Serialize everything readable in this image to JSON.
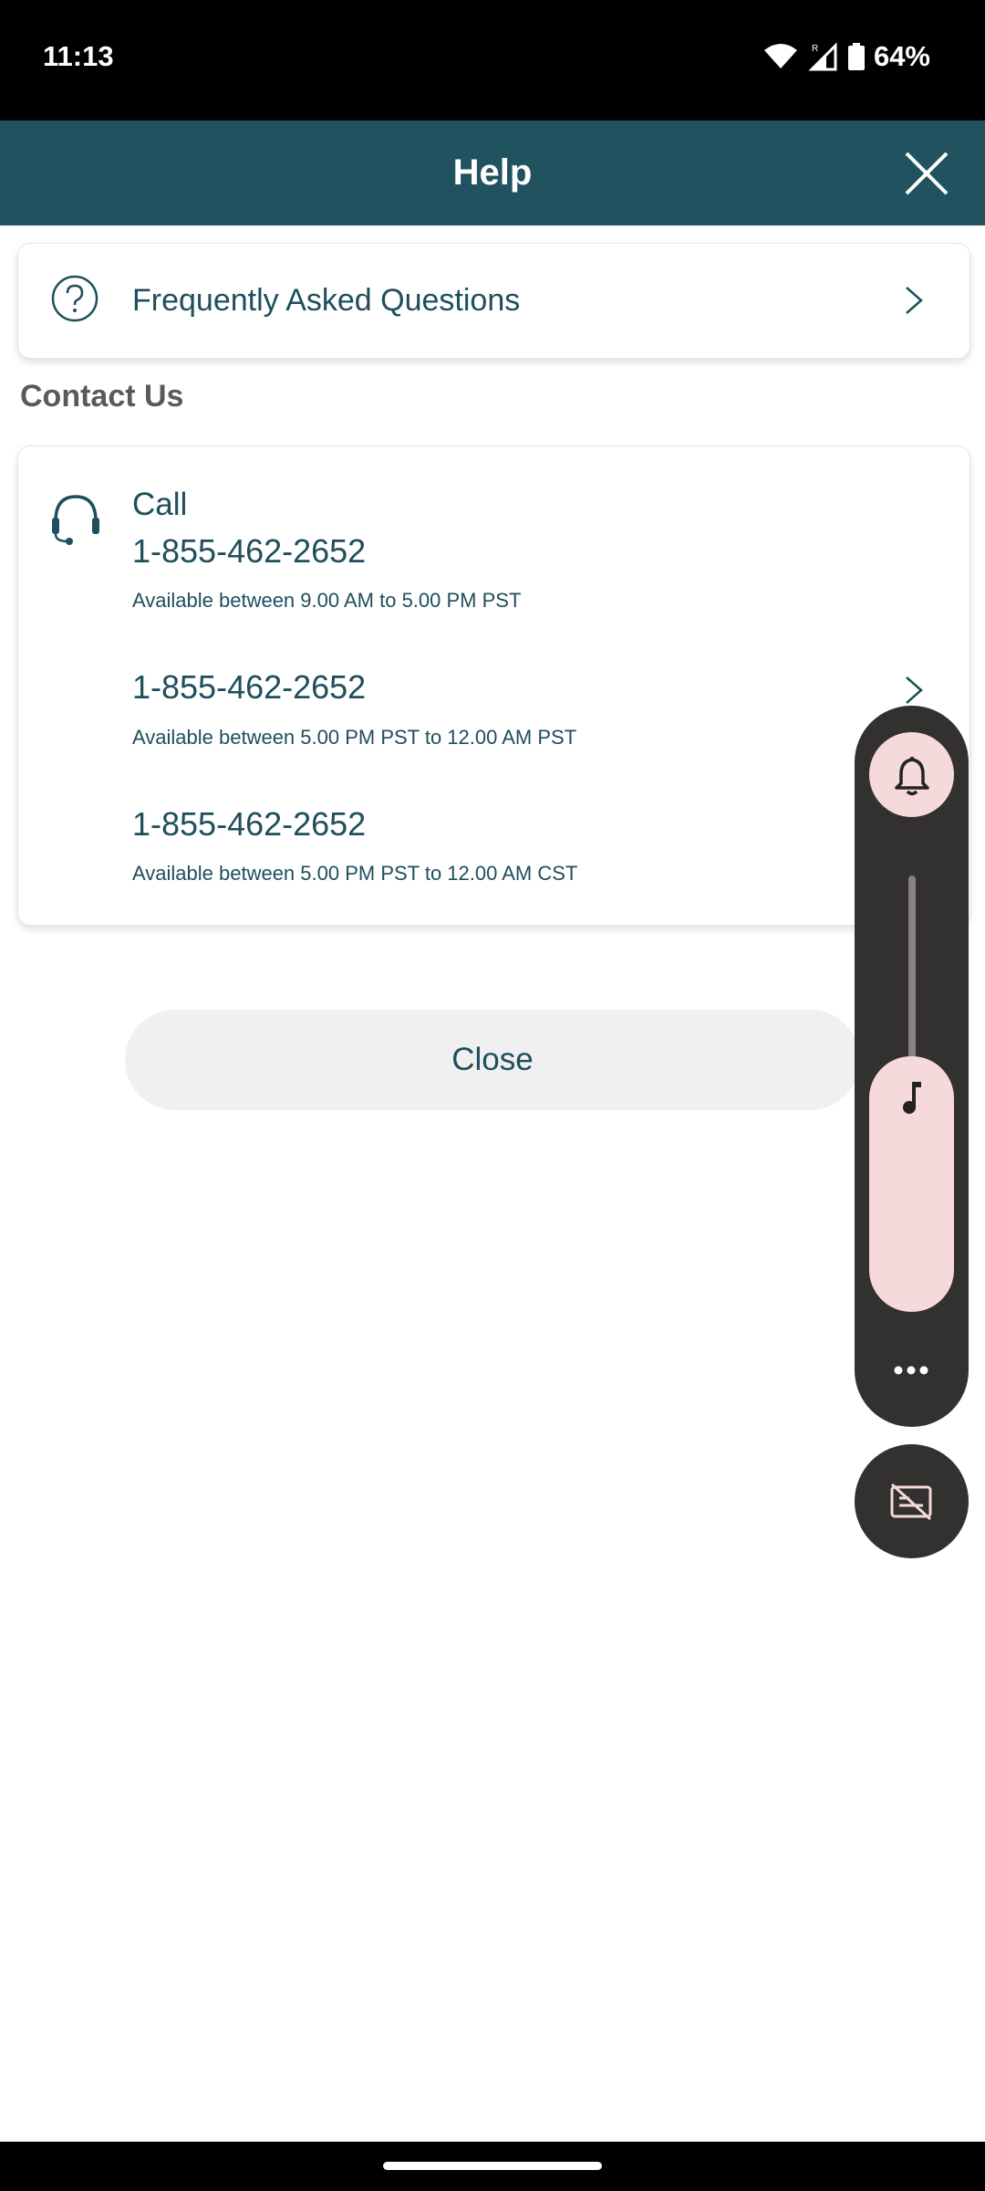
{
  "status_bar": {
    "time": "11:13",
    "signal_badge": "R",
    "battery": "64%"
  },
  "header": {
    "title": "Help",
    "close_icon": "close-icon"
  },
  "faq": {
    "label": "Frequently Asked Questions",
    "icon": "question-circle-icon"
  },
  "contact": {
    "section_title": "Contact Us",
    "call_label": "Call",
    "icon": "headset-icon",
    "numbers": [
      {
        "phone": "1-855-462-2652",
        "availability": "Available between 9.00 AM to 5.00 PM PST"
      },
      {
        "phone": "1-855-462-2652",
        "availability": "Available between 5.00 PM PST to 12.00 AM PST"
      },
      {
        "phone": "1-855-462-2652",
        "availability": "Available between 5.00 PM PST to 12.00 AM CST"
      }
    ]
  },
  "actions": {
    "close_label": "Close"
  },
  "volume_overlay": {
    "ringer_icon": "bell-icon",
    "media_icon": "music-note-icon",
    "more_icon": "more-dots-icon",
    "captions_icon": "captions-off-icon",
    "level": 0.5
  },
  "colors": {
    "app_bar": "#215260",
    "text_primary": "#1f4e5c",
    "overlay_bg": "#333130",
    "overlay_accent": "#f6d9db"
  }
}
